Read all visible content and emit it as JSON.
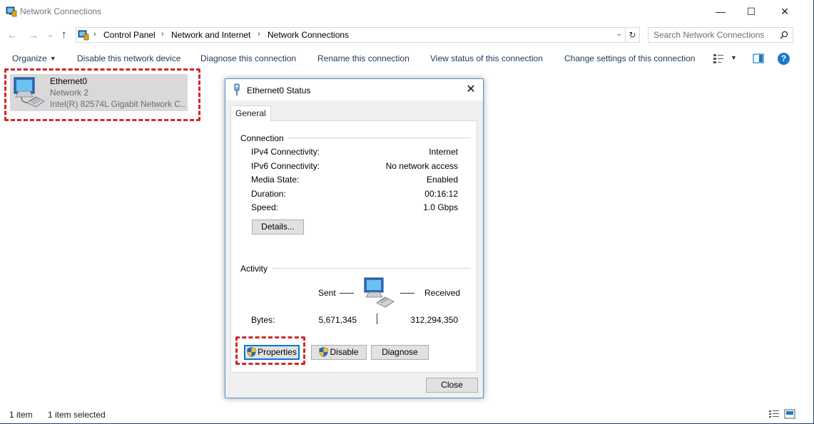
{
  "window": {
    "title": "Network Connections",
    "minimize_glyph": "—",
    "maximize_glyph": "☐",
    "close_glyph": "✕"
  },
  "nav": {
    "back_glyph": "←",
    "forward_glyph": "→",
    "recent_glyph": "⌄",
    "up_glyph": "↑"
  },
  "address": {
    "crumbs": [
      "Control Panel",
      "Network and Internet",
      "Network Connections"
    ],
    "separator": "›",
    "dropdown_glyph": "⌄",
    "refresh_glyph": "↻"
  },
  "search": {
    "placeholder": "Search Network Connections"
  },
  "toolbar": {
    "organize": "Organize",
    "organize_caret": "▼",
    "disable": "Disable this network device",
    "diagnose": "Diagnose this connection",
    "rename": "Rename this connection",
    "view_status": "View status of this connection",
    "change_settings": "Change settings of this connection",
    "view_caret": "▼",
    "help_glyph": "?"
  },
  "item": {
    "name": "Ethernet0",
    "network": "Network  2",
    "device": "Intel(R) 82574L Gigabit Network C...",
    "selected": true
  },
  "statusbar": {
    "count": "1 item",
    "selected": "1 item selected"
  },
  "dialog": {
    "title": "Ethernet0 Status",
    "close_glyph": "✕",
    "tab": "General",
    "connection": {
      "heading": "Connection",
      "rows": [
        {
          "label": "IPv4 Connectivity:",
          "value": "Internet"
        },
        {
          "label": "IPv6 Connectivity:",
          "value": "No network access"
        },
        {
          "label": "Media State:",
          "value": "Enabled"
        },
        {
          "label": "Duration:",
          "value": "00:16:12"
        },
        {
          "label": "Speed:",
          "value": "1.0 Gbps"
        }
      ],
      "details_button": "Details..."
    },
    "activity": {
      "heading": "Activity",
      "sent_label": "Sent",
      "received_label": "Received",
      "bytes_label": "Bytes:",
      "bytes_sent": "5,671,345",
      "bytes_received": "312,294,350"
    },
    "buttons": {
      "properties": "Properties",
      "disable": "Disable",
      "diagnose": "Diagnose",
      "close": "Close"
    }
  },
  "colors": {
    "accent": "#0078d7",
    "highlight_dash": "#d12727",
    "command_text": "#1e395b",
    "selection": "#d9d9d9"
  },
  "icons": {
    "app": "network-connections-icon",
    "item": "network-adapter-icon",
    "activity": "network-activity-icon",
    "shield": "uac-shield-icon"
  }
}
